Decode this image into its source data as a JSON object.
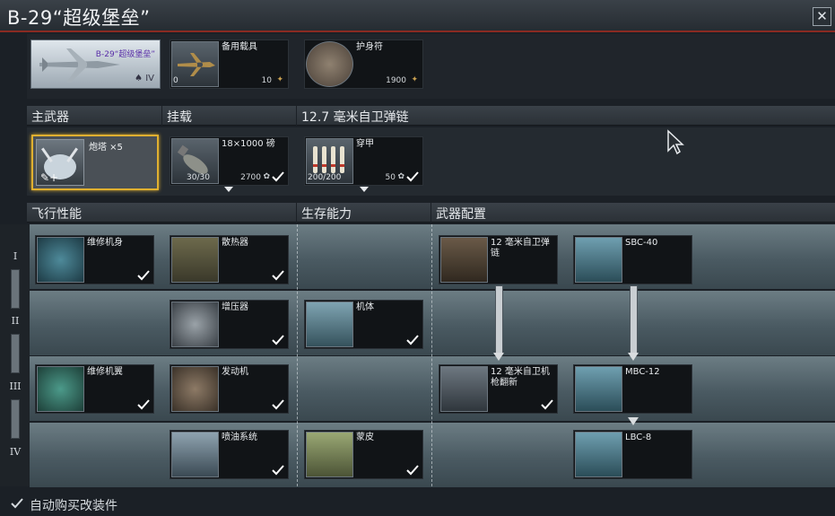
{
  "window": {
    "title": "B-29“超级堡垒”",
    "close_label": "✕"
  },
  "top": {
    "aircraft": {
      "name": "B-29“超级堡垒”",
      "rank": "♠ IV"
    },
    "backup": {
      "label": "备用载具",
      "count": "0",
      "cost": "10"
    },
    "talisman": {
      "label": "护身符",
      "cost": "1900"
    }
  },
  "sections": {
    "main_weapon": "主武器",
    "payload": "挂载",
    "belts": "12.7 毫米自卫弹链",
    "flight": "飞行性能",
    "survivability": "生存能力",
    "weapons": "武器配置"
  },
  "loadout": {
    "turret": {
      "label": "炮塔 ×5"
    },
    "bombs": {
      "label": "18×1000 磅",
      "ammo": "30/30",
      "cost": "2700"
    },
    "belt": {
      "label": "穿甲",
      "ammo": "200/200",
      "cost": "50"
    }
  },
  "modules": {
    "repair_fuselage": "维修机身",
    "radiator": "散热器",
    "belts12": "12 毫米自卫弹链",
    "sbc40": "SBC-40",
    "supercharger": "增压器",
    "airframe": "机体",
    "repair_wings": "维修机翼",
    "engine": "发动机",
    "turret12": "12 毫米自卫机枪翻新",
    "mbc12": "MBC-12",
    "injection": "喷油系统",
    "cover": "蒙皮",
    "lbc8": "LBC-8"
  },
  "tiers": [
    "I",
    "II",
    "III",
    "IV"
  ],
  "footer": {
    "auto_buy": "自动购买改装件"
  },
  "colors": {
    "accent": "#e0b030",
    "title_rule": "#8a2a22",
    "row_bg": "#5d6d75"
  }
}
